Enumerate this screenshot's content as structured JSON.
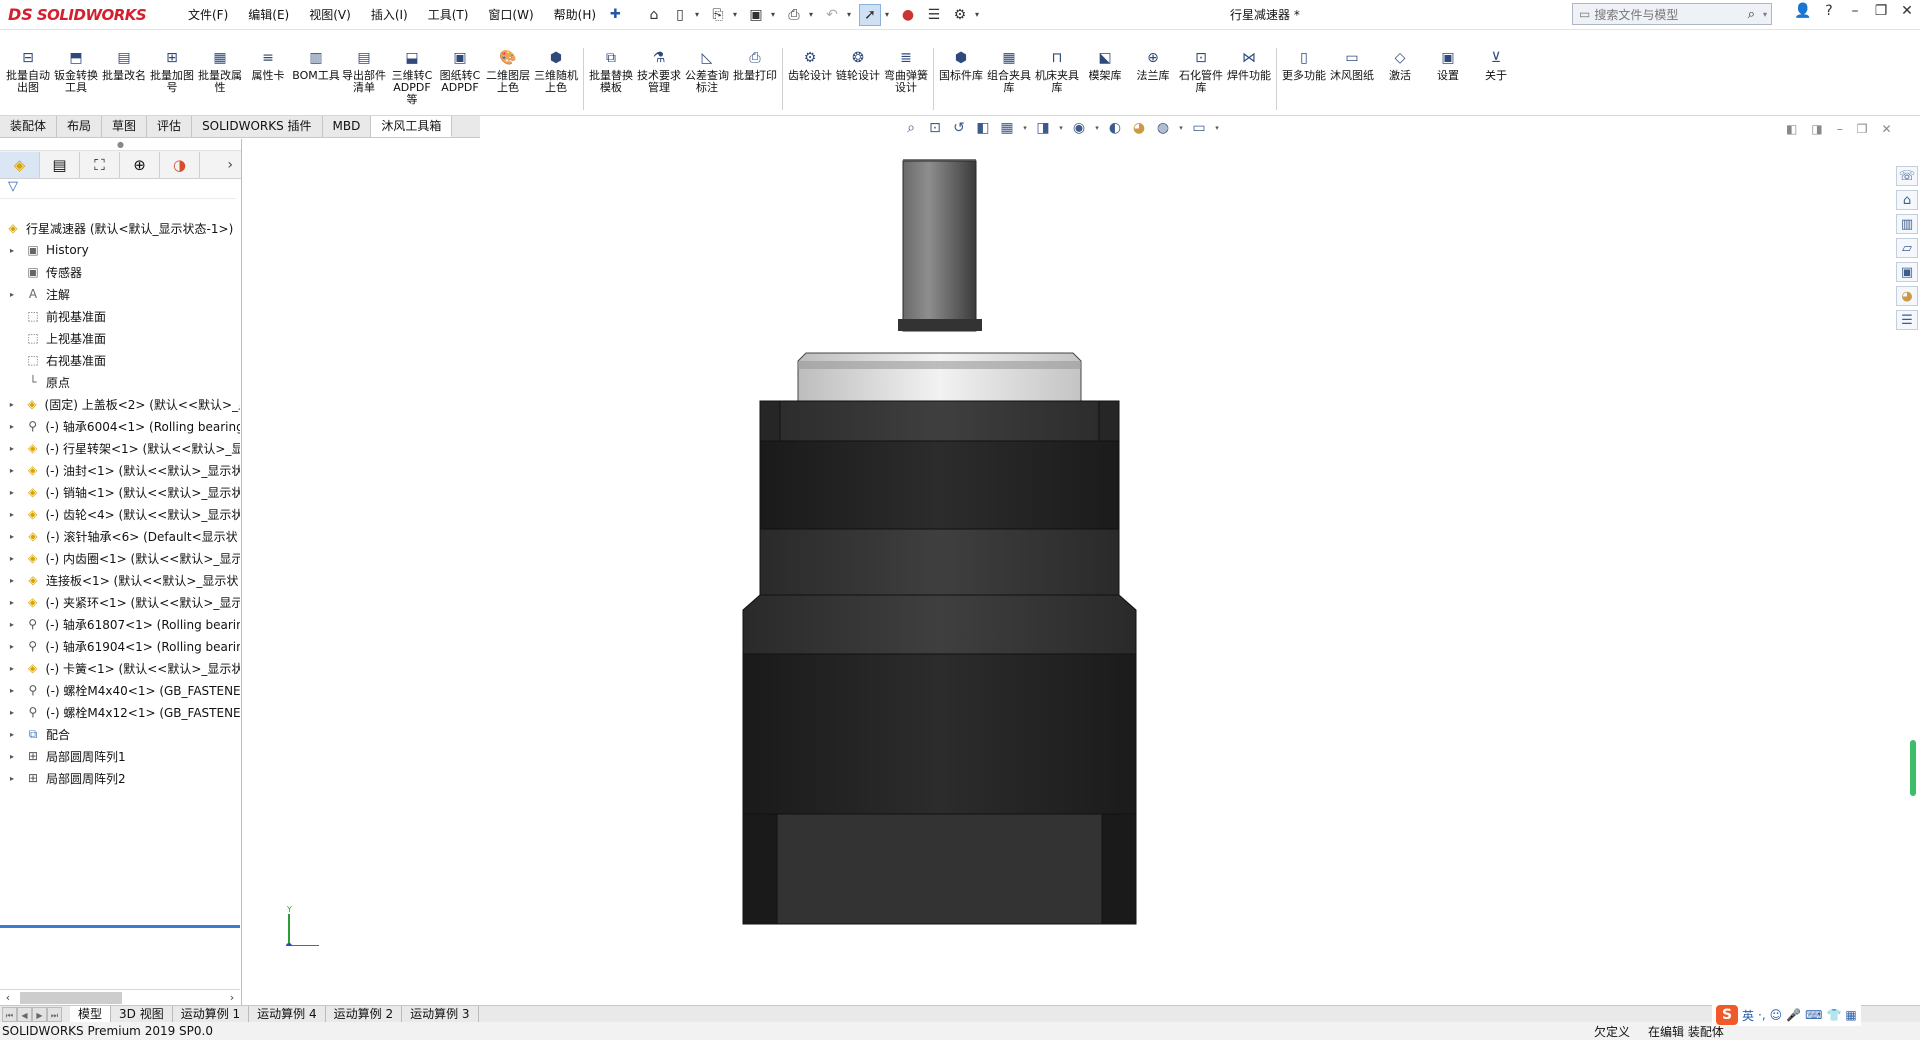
{
  "app": {
    "logo_ds": "DS",
    "logo_name": "SOLIDWORKS",
    "document_title": "行星减速器 *"
  },
  "menu": [
    "文件(F)",
    "编辑(E)",
    "视图(V)",
    "插入(I)",
    "工具(T)",
    "窗口(W)",
    "帮助(H)"
  ],
  "search": {
    "placeholder": "搜索文件与模型"
  },
  "ribbon": [
    {
      "label": "批量自动出图",
      "icon": "drawing-icon"
    },
    {
      "label": "钣金转换工具",
      "icon": "sheetmetal-icon"
    },
    {
      "label": "批量改名",
      "icon": "rename-icon"
    },
    {
      "label": "批量加图号",
      "icon": "number-icon"
    },
    {
      "label": "批量改属性",
      "icon": "property-icon"
    },
    {
      "label": "属性卡",
      "icon": "card-icon"
    },
    {
      "label": "BOM工具",
      "icon": "bom-icon"
    },
    {
      "label": "导出部件清单",
      "icon": "export-icon"
    },
    {
      "label": "三维转CADPDF等",
      "icon": "convert3d-icon"
    },
    {
      "label": "图纸转CADPDF",
      "icon": "convert2d-icon"
    },
    {
      "label": "二维图层上色",
      "icon": "palette-icon"
    },
    {
      "label": "三维随机上色",
      "icon": "random-color-icon"
    },
    {
      "label": "批量替换模板",
      "icon": "template-icon"
    },
    {
      "label": "技术要求管理",
      "icon": "requirement-icon"
    },
    {
      "label": "公差查询标注",
      "icon": "tolerance-icon"
    },
    {
      "label": "批量打印",
      "icon": "printer-icon"
    },
    {
      "label": "齿轮设计",
      "icon": "gear-icon"
    },
    {
      "label": "链轮设计",
      "icon": "sprocket-icon"
    },
    {
      "label": "弯曲弹簧设计",
      "icon": "spring-icon"
    },
    {
      "label": "国标件库",
      "icon": "nut-icon"
    },
    {
      "label": "组合夹具库",
      "icon": "fixture-icon"
    },
    {
      "label": "机床夹具库",
      "icon": "clamp-icon"
    },
    {
      "label": "模架库",
      "icon": "mold-icon"
    },
    {
      "label": "法兰库",
      "icon": "flange-icon"
    },
    {
      "label": "石化管件库",
      "icon": "pipe-icon"
    },
    {
      "label": "焊件功能",
      "icon": "weld-icon"
    },
    {
      "label": "更多功能",
      "icon": "more-icon"
    },
    {
      "label": "沐风图纸",
      "icon": "sheet-icon"
    },
    {
      "label": "激活",
      "icon": "diamond-icon"
    },
    {
      "label": "设置",
      "icon": "settings-icon"
    },
    {
      "label": "关于",
      "icon": "about-icon"
    }
  ],
  "tabs": [
    "装配体",
    "布局",
    "草图",
    "评估",
    "SOLIDWORKS 插件",
    "MBD",
    "沐风工具箱"
  ],
  "active_tab": "沐风工具箱",
  "tree": [
    {
      "label": "行星减速器 (默认<默认_显示状态-1>)",
      "icon": "assembly-icon",
      "expand": false,
      "root": true
    },
    {
      "label": "History",
      "icon": "history-icon",
      "expand": true
    },
    {
      "label": "传感器",
      "icon": "sensor-icon",
      "expand": false
    },
    {
      "label": "注解",
      "icon": "annotation-icon",
      "expand": true
    },
    {
      "label": "前视基准面",
      "icon": "plane-icon",
      "expand": false
    },
    {
      "label": "上视基准面",
      "icon": "plane-icon",
      "expand": false
    },
    {
      "label": "右视基准面",
      "icon": "plane-icon",
      "expand": false
    },
    {
      "label": "原点",
      "icon": "origin-icon",
      "expand": false
    },
    {
      "label": "(固定) 上盖板<2> (默认<<默认>_显",
      "icon": "part-icon",
      "expand": true
    },
    {
      "label": "(-) 轴承6004<1> (Rolling bearing",
      "icon": "bolt-icon",
      "expand": true
    },
    {
      "label": "(-) 行星转架<1> (默认<<默认>_显",
      "icon": "part-icon",
      "expand": true
    },
    {
      "label": "(-) 油封<1> (默认<<默认>_显示状",
      "icon": "part-icon",
      "expand": true
    },
    {
      "label": "(-) 销轴<1> (默认<<默认>_显示状",
      "icon": "part-icon",
      "expand": true
    },
    {
      "label": "(-) 齿轮<4> (默认<<默认>_显示状",
      "icon": "part-icon",
      "expand": true
    },
    {
      "label": "(-) 滚针轴承<6> (Default<显示状",
      "icon": "part-icon",
      "expand": true
    },
    {
      "label": "(-) 内齿圈<1> (默认<<默认>_显示",
      "icon": "part-icon",
      "expand": true
    },
    {
      "label": "连接板<1> (默认<<默认>_显示状",
      "icon": "part-icon",
      "expand": true
    },
    {
      "label": "(-) 夹紧环<1> (默认<<默认>_显示",
      "icon": "part-icon",
      "expand": true
    },
    {
      "label": "(-) 轴承61807<1> (Rolling bearin",
      "icon": "bolt-icon",
      "expand": true
    },
    {
      "label": "(-) 轴承61904<1> (Rolling bearin",
      "icon": "bolt-icon",
      "expand": true
    },
    {
      "label": "(-) 卡簧<1> (默认<<默认>_显示状",
      "icon": "part-icon",
      "expand": true
    },
    {
      "label": "(-) 螺栓M4x40<1> (GB_FASTENE",
      "icon": "bolt-icon",
      "expand": true
    },
    {
      "label": "(-) 螺栓M4x12<1> (GB_FASTENE",
      "icon": "bolt-icon",
      "expand": true
    },
    {
      "label": "配合",
      "icon": "mate-icon",
      "expand": true
    },
    {
      "label": "局部圆周阵列1",
      "icon": "pattern-icon",
      "expand": true
    },
    {
      "label": "局部圆周阵列2",
      "icon": "pattern-icon",
      "expand": true
    }
  ],
  "bottom_tabs": [
    "模型",
    "3D 视图",
    "运动算例 1",
    "运动算例 4",
    "运动算例 2",
    "运动算例 3"
  ],
  "active_bottom_tab": "模型",
  "status": {
    "version": "SOLIDWORKS Premium 2019 SP0.0",
    "undefined": "欠定义",
    "editing": "在编辑 装配体"
  },
  "ime": {
    "lang": "英"
  },
  "colors": {
    "brand": "#d2202f",
    "accent": "#3a7cd0",
    "scroll": "#3dbd69"
  }
}
